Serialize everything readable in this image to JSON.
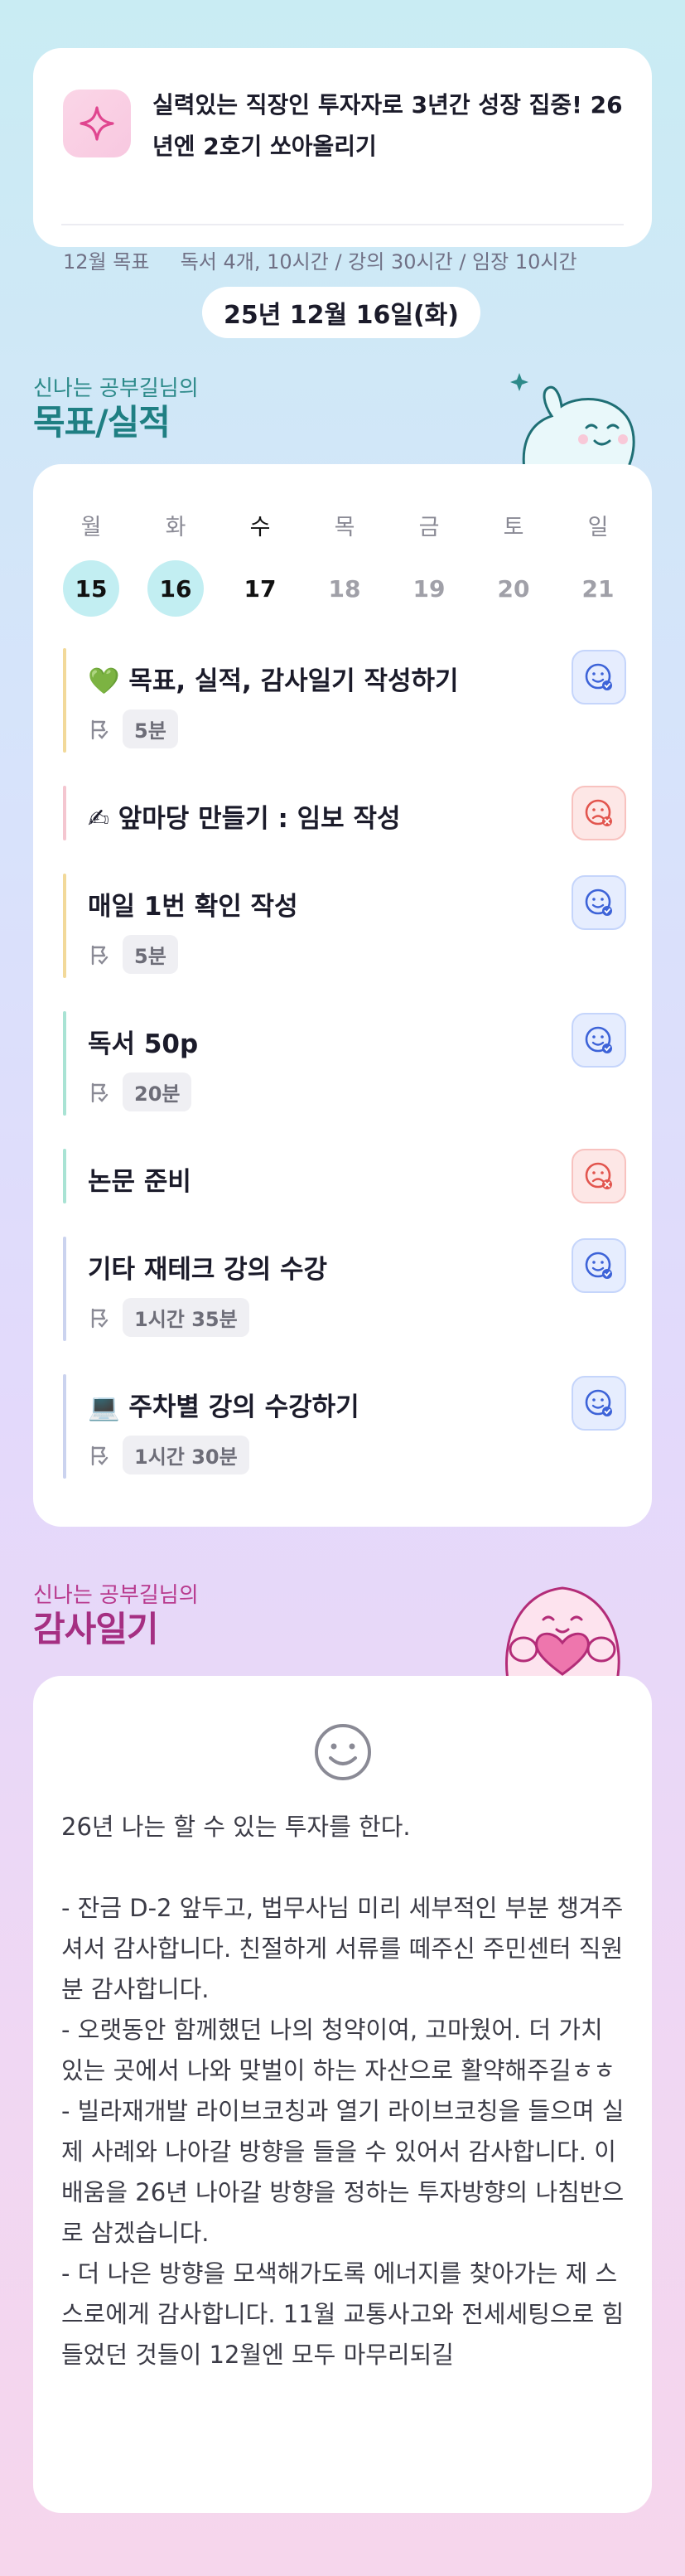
{
  "goal": {
    "title": "실력있는 직장인 투자자로 3년간 성장 집중! 26년엔 2호기 쏘아올리기",
    "month_label": "12월 목표",
    "targets": [
      "독서 4개, 10시간",
      "강의 30시간",
      "임장 10시간"
    ]
  },
  "date_label": "25년 12월 16일(화)",
  "targets_section": {
    "subtitle": "신나는 공부길님의",
    "title": "목표/실적",
    "color": "#1f7f83"
  },
  "week": [
    {
      "label": "월",
      "num": "15",
      "state": "done"
    },
    {
      "label": "화",
      "num": "16",
      "state": "done"
    },
    {
      "label": "수",
      "num": "17",
      "state": "today"
    },
    {
      "label": "목",
      "num": "18",
      "state": "future"
    },
    {
      "label": "금",
      "num": "19",
      "state": "future"
    },
    {
      "label": "토",
      "num": "20",
      "state": "future"
    },
    {
      "label": "일",
      "num": "21",
      "state": "future"
    }
  ],
  "tasks": [
    {
      "title": "💚 목표, 실적, 감사일기 작성하기",
      "time": "5분",
      "status": "success",
      "bar_color": "#f2d99a"
    },
    {
      "title": "✍ 앞마당 만들기 : 임보 작성",
      "time": "",
      "status": "fail",
      "bar_color": "#f4c6d0"
    },
    {
      "title": "매일 1번 확인 작성",
      "time": "5분",
      "status": "success",
      "bar_color": "#f2d99a"
    },
    {
      "title": "독서 50p",
      "time": "20분",
      "status": "success",
      "bar_color": "#a9e3d4"
    },
    {
      "title": "논문 준비",
      "time": "",
      "status": "fail",
      "bar_color": "#a9e3d4"
    },
    {
      "title": "기타 재테크 강의 수강",
      "time": "1시간 35분",
      "status": "success",
      "bar_color": "#cbd3ef"
    },
    {
      "title": "💻 주차별 강의 수강하기",
      "time": "1시간 30분",
      "status": "success",
      "bar_color": "#cbd3ef"
    }
  ],
  "diary_section": {
    "subtitle": "신나는 공부길님의",
    "title": "감사일기",
    "color": "#b83a8e"
  },
  "diary_text": "26년 나는 할 수 있는 투자를 한다.\n\n- 잔금 D-2 앞두고, 법무사님 미리 세부적인 부분 챙겨주셔서 감사합니다. 친절하게 서류를 떼주신 주민센터 직원분 감사합니다.\n- 오랫동안 함께했던 나의 청약이여, 고마웠어. 더 가치있는 곳에서 나와 맞벌이 하는 자산으로 활약해주길ㅎㅎ\n- 빌라재개발 라이브코칭과 열기 라이브코칭을 들으며 실제 사례와 나아갈 방향을 들을 수 있어서 감사합니다. 이 배움을 26년 나아갈 방향을 정하는 투자방향의 나침반으로 삼겠습니다.\n- 더 나은 방향을 모색해가도록 에너지를 찾아가는 제 스스로에게 감사합니다. 11월 교통사고와 전세세팅으로 힘들었던 것들이 12월엔 모두 마무리되길",
  "colors": {
    "success": "#3d63d8",
    "fail": "#e2554e",
    "today_ring": "#c2eef2"
  }
}
